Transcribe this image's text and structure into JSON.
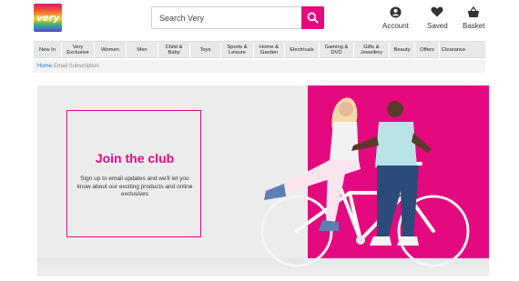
{
  "header": {
    "logo_text": "very",
    "search_placeholder": "Search Very",
    "links": {
      "account": "Account",
      "saved": "Saved",
      "basket": "Basket"
    }
  },
  "nav": {
    "items": [
      "New In",
      "Very\nExclusive",
      "Women",
      "Men",
      "Child &\nBaby",
      "Toys",
      "Sports &\nLeisure",
      "Home &\nGarden",
      "Electricals",
      "Gaming &\nDVD",
      "Gifts &\nJewellery",
      "Beauty",
      "Offers",
      "Clearance"
    ]
  },
  "breadcrumb": {
    "home": "Home",
    "current": "Email Subscription"
  },
  "hero": {
    "title": "Join the club",
    "text": "Sign up to email updates and we'll let you know about our exciting products and online exclusives"
  },
  "colors": {
    "brand": "#e4097e",
    "nav_bg": "#e8e8e8",
    "hero_bg": "#ececed"
  },
  "icons": [
    "search-icon",
    "account-icon",
    "heart-icon",
    "basket-icon"
  ]
}
